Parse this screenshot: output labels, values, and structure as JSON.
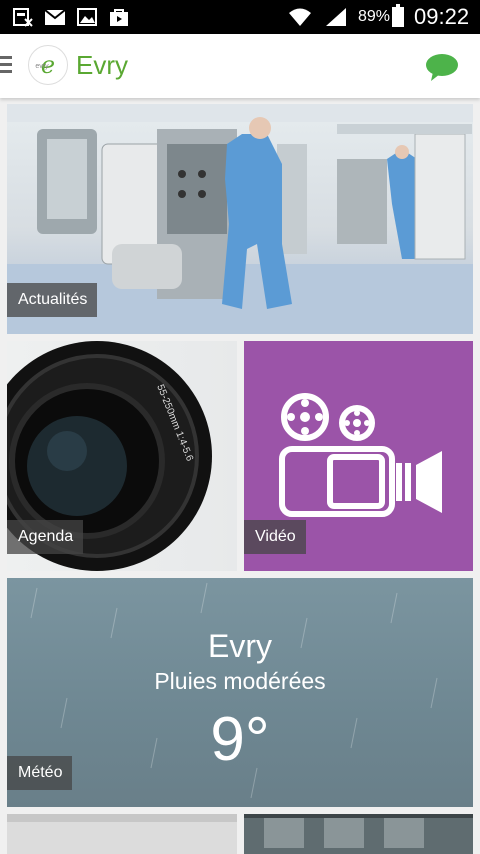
{
  "status_bar": {
    "battery": "89%",
    "time": "09:22"
  },
  "app_bar": {
    "title": "Evry",
    "logo_text": "evry"
  },
  "tiles": {
    "news": {
      "label": "Actualités"
    },
    "agenda": {
      "label": "Agenda",
      "lens_text": "55-250mm 1:4-5.6"
    },
    "video": {
      "label": "Vidéo"
    },
    "meteo": {
      "label": "Météo",
      "city": "Evry",
      "description": "Pluies modérées",
      "temperature": "9°"
    }
  },
  "colors": {
    "brand_green": "#5aa832",
    "video_purple": "#9b54a8",
    "meteo_slate": "#73909b"
  }
}
